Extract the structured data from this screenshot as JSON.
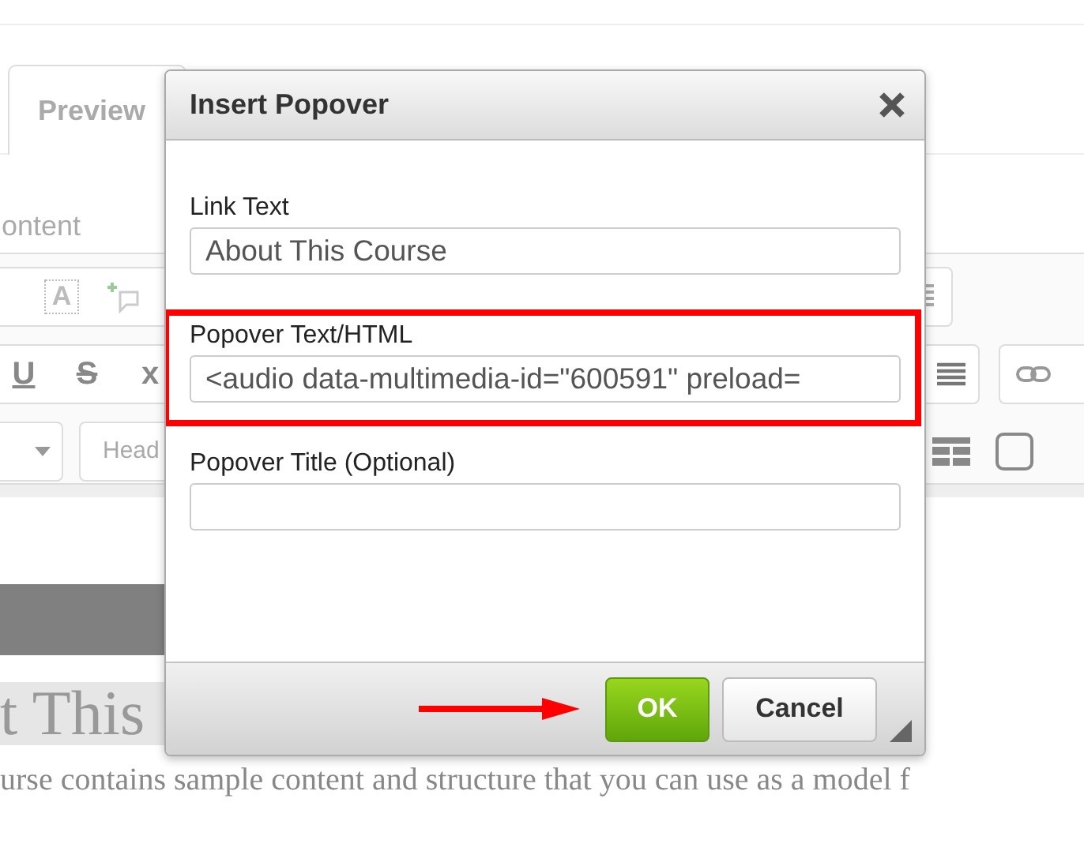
{
  "editor": {
    "tab": {
      "label": "Preview",
      "selected": true
    },
    "section_label": "ontent",
    "toolbar": {
      "style_glyph": "A",
      "format_buttons": [
        "U",
        "S",
        "x"
      ],
      "heading_dropdown": "Head"
    },
    "heading": "t This",
    "body_text": "urse contains sample content and structure that you can use as a model f"
  },
  "dialog": {
    "title": "Insert Popover",
    "fields": [
      {
        "label": "Link Text",
        "value": "About This Course",
        "highlighted": false
      },
      {
        "label": "Popover Text/HTML",
        "value": "<audio data-multimedia-id=\"600591\" preload=",
        "highlighted": true
      },
      {
        "label": "Popover Title (Optional)",
        "highlighted": false
      }
    ],
    "buttons": [
      {
        "label": "OK",
        "kind": "primary",
        "pointed_at": true
      },
      {
        "label": "Cancel",
        "kind": "default",
        "pointed_at": false
      }
    ]
  }
}
